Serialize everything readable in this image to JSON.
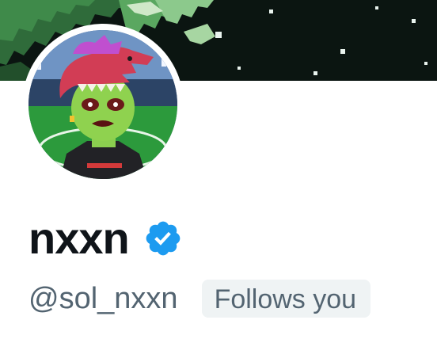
{
  "profile": {
    "display_name": "nxxn",
    "handle": "@sol_nxxn",
    "follows_you_label": "Follows you",
    "verified": true
  },
  "icons": {
    "verified": "verified-badge-icon"
  },
  "colors": {
    "name_text": "#0f1419",
    "secondary_text": "#536471",
    "badge_background": "#eff3f4",
    "verified_blue": "#1d9bf0",
    "banner_background": "#0b1511"
  }
}
